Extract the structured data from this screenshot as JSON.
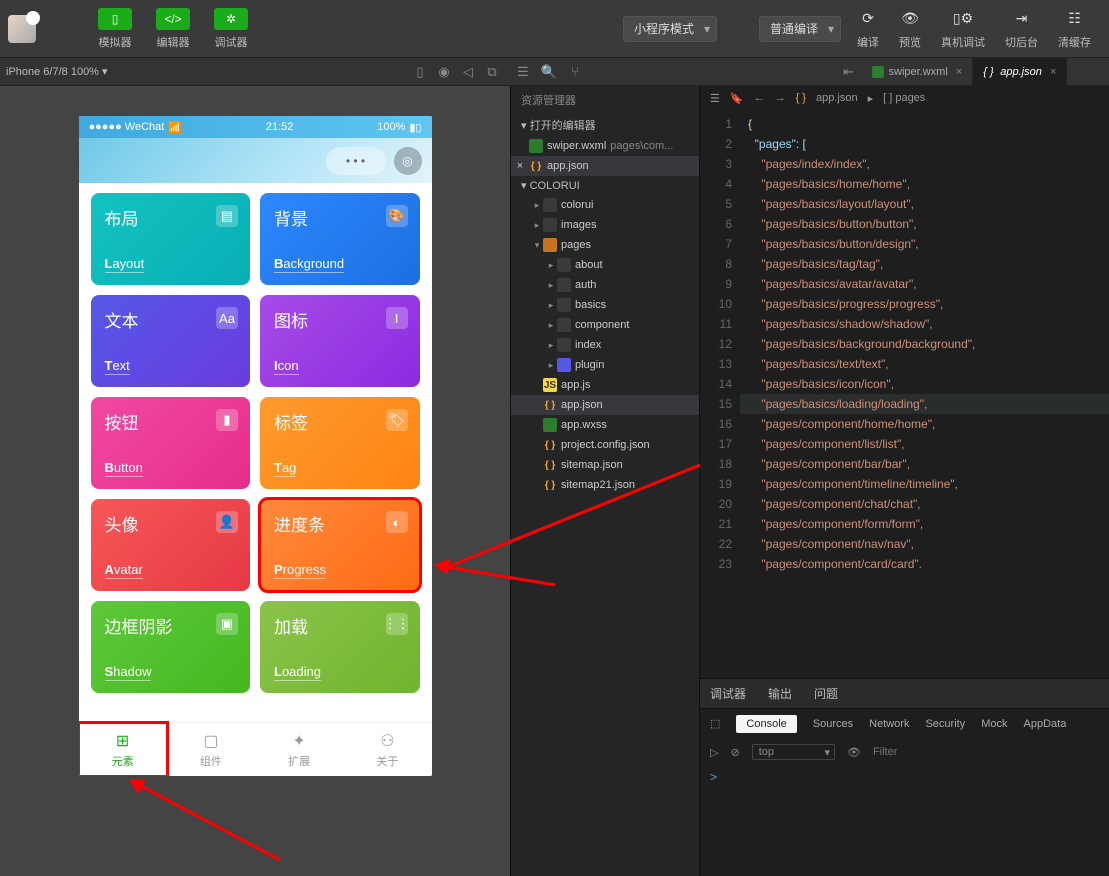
{
  "topbar": {
    "simulator": "模拟器",
    "editor": "编辑器",
    "debugger": "调试器",
    "mode": "小程序模式",
    "compile": "普通编译",
    "right": {
      "compileBtn": "编译",
      "preview": "预览",
      "realdbg": "真机调试",
      "bg": "切后台",
      "clear": "清缓存"
    }
  },
  "secbar": {
    "device": "iPhone 6/7/8 100%",
    "down": "▾"
  },
  "tabs": [
    {
      "icon": "wx",
      "label": "swiper.wxml",
      "active": false
    },
    {
      "icon": "json",
      "label": "app.json",
      "active": true
    }
  ],
  "tree": {
    "title": "资源管理器",
    "open": "打开的编辑器",
    "openItems": [
      {
        "icon": "wx",
        "label": "swiper.wxml",
        "gray": "pages\\com..."
      },
      {
        "pre": "×",
        "icon": "json",
        "label": "app.json",
        "sel": true
      }
    ],
    "root": "COLORUI",
    "items": [
      {
        "d": 1,
        "arr": "▸",
        "icon": "folder",
        "label": "colorui"
      },
      {
        "d": 1,
        "arr": "▸",
        "icon": "folder",
        "label": "images"
      },
      {
        "d": 1,
        "arr": "▾",
        "icon": "folder2",
        "label": "pages"
      },
      {
        "d": 2,
        "arr": "▸",
        "icon": "folder",
        "label": "about"
      },
      {
        "d": 2,
        "arr": "▸",
        "icon": "folder",
        "label": "auth"
      },
      {
        "d": 2,
        "arr": "▸",
        "icon": "folder",
        "label": "basics"
      },
      {
        "d": 2,
        "arr": "▸",
        "icon": "folder",
        "label": "component"
      },
      {
        "d": 2,
        "arr": "▸",
        "icon": "folder",
        "label": "index"
      },
      {
        "d": 2,
        "arr": "▸",
        "icon": "p",
        "label": "plugin"
      },
      {
        "d": 1,
        "arr": "",
        "icon": "js",
        "label": "app.js"
      },
      {
        "d": 1,
        "arr": "",
        "icon": "json",
        "label": "app.json",
        "sel": true
      },
      {
        "d": 1,
        "arr": "",
        "icon": "wx",
        "label": "app.wxss"
      },
      {
        "d": 1,
        "arr": "",
        "icon": "json",
        "label": "project.config.json"
      },
      {
        "d": 1,
        "arr": "",
        "icon": "json",
        "label": "sitemap.json"
      },
      {
        "d": 1,
        "arr": "",
        "icon": "json",
        "label": "sitemap21.json"
      }
    ]
  },
  "crumb": {
    "file": "app.json",
    "sep": "▸",
    "arr": "[ ] pages"
  },
  "code": [
    {
      "n": 1,
      "t": "{",
      "cls": "o",
      "ind": 0
    },
    {
      "n": 2,
      "t": "\"pages\": [",
      "cls": "k",
      "ind": 1,
      "tail": ""
    },
    {
      "n": 3,
      "t": "\"pages/index/index\",",
      "cls": "y",
      "ind": 2
    },
    {
      "n": 4,
      "t": "\"pages/basics/home/home\",",
      "cls": "y",
      "ind": 2
    },
    {
      "n": 5,
      "t": "\"pages/basics/layout/layout\",",
      "cls": "y",
      "ind": 2
    },
    {
      "n": 6,
      "t": "\"pages/basics/button/button\",",
      "cls": "y",
      "ind": 2
    },
    {
      "n": 7,
      "t": "\"pages/basics/button/design\",",
      "cls": "y",
      "ind": 2
    },
    {
      "n": 8,
      "t": "\"pages/basics/tag/tag\",",
      "cls": "y",
      "ind": 2
    },
    {
      "n": 9,
      "t": "\"pages/basics/avatar/avatar\",",
      "cls": "y",
      "ind": 2
    },
    {
      "n": 10,
      "t": "\"pages/basics/progress/progress\",",
      "cls": "y",
      "ind": 2
    },
    {
      "n": 11,
      "t": "\"pages/basics/shadow/shadow\",",
      "cls": "y",
      "ind": 2
    },
    {
      "n": 12,
      "t": "\"pages/basics/background/background\",",
      "cls": "y",
      "ind": 2
    },
    {
      "n": 13,
      "t": "\"pages/basics/text/text\",",
      "cls": "y",
      "ind": 2
    },
    {
      "n": 14,
      "t": "\"pages/basics/icon/icon\",",
      "cls": "y",
      "ind": 2
    },
    {
      "n": 15,
      "t": "\"pages/basics/loading/loading\",",
      "cls": "y",
      "ind": 2,
      "hl": true
    },
    {
      "n": 16,
      "t": "\"pages/component/home/home\",",
      "cls": "y",
      "ind": 2
    },
    {
      "n": 17,
      "t": "\"pages/component/list/list\",",
      "cls": "y",
      "ind": 2
    },
    {
      "n": 18,
      "t": "\"pages/component/bar/bar\",",
      "cls": "y",
      "ind": 2
    },
    {
      "n": 19,
      "t": "\"pages/component/timeline/timeline\",",
      "cls": "y",
      "ind": 2
    },
    {
      "n": 20,
      "t": "\"pages/component/chat/chat\",",
      "cls": "y",
      "ind": 2
    },
    {
      "n": 21,
      "t": "\"pages/component/form/form\",",
      "cls": "y",
      "ind": 2
    },
    {
      "n": 22,
      "t": "\"pages/component/nav/nav\",",
      "cls": "y",
      "ind": 2
    },
    {
      "n": 23,
      "t": "\"pages/component/card/card\".",
      "cls": "y",
      "ind": 2
    }
  ],
  "phone": {
    "status": {
      "left": "●●●●● WeChat",
      "wifi": "📶",
      "time": "21:52",
      "batt": "100%"
    },
    "nav": {
      "dots": "• • •",
      "ring": "◎"
    },
    "cards": [
      {
        "zh": "布局",
        "en": "Layout",
        "cls": "c0",
        "icon": "▤"
      },
      {
        "zh": "背景",
        "en": "Background",
        "cls": "c1",
        "icon": "🎨"
      },
      {
        "zh": "文本",
        "en": "Text",
        "cls": "c2",
        "icon": "Aa"
      },
      {
        "zh": "图标",
        "en": "Icon",
        "cls": "c3",
        "icon": "I"
      },
      {
        "zh": "按钮",
        "en": "Button",
        "cls": "c4",
        "icon": "▮"
      },
      {
        "zh": "标签",
        "en": "Tag",
        "cls": "c5",
        "icon": "🏷"
      },
      {
        "zh": "头像",
        "en": "Avatar",
        "cls": "c6",
        "icon": "👤"
      },
      {
        "zh": "进度条",
        "en": "Progress",
        "cls": "c7",
        "icon": "◐",
        "hl": true
      },
      {
        "zh": "边框阴影",
        "en": "Shadow",
        "cls": "c8",
        "icon": "▣"
      },
      {
        "zh": "加载",
        "en": "Loading",
        "cls": "c9",
        "icon": "⋮⋮"
      }
    ],
    "tabbar": [
      {
        "label": "元素",
        "icon": "⊞",
        "active": true,
        "hl": true
      },
      {
        "label": "组件",
        "icon": "▢",
        "active": false
      },
      {
        "label": "扩展",
        "icon": "✦",
        "active": false
      },
      {
        "label": "关于",
        "icon": "⚇",
        "active": false
      }
    ]
  },
  "bottom": {
    "tabs": [
      "调试器",
      "输出",
      "问题"
    ],
    "consoleTabs": [
      "Console",
      "Sources",
      "Network",
      "Security",
      "Mock",
      "AppData"
    ],
    "top": "top",
    "filter": "Filter",
    "prompt": ">"
  }
}
